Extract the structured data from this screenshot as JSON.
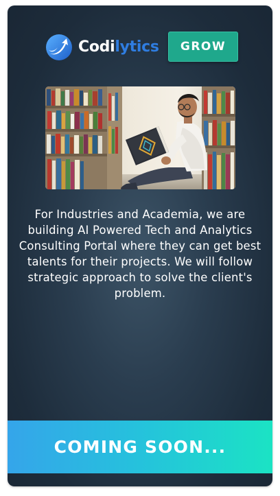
{
  "brand": {
    "name_part1": "Codi",
    "name_part2": "lytics",
    "logo_icon": "arrow-swoosh-icon"
  },
  "header": {
    "cta_label": "GROW"
  },
  "hero": {
    "image_icon": "student-reading-library-image"
  },
  "main": {
    "description": "For Industries and Academia, we are building AI Powered Tech and Analytics Consulting Portal where they can get best talents for their projects. We will follow strategic approach to solve the client's problem."
  },
  "footer": {
    "status_text": "COMING SOON..."
  },
  "colors": {
    "card_background": "#1d2c3b",
    "accent_blue": "#2f7de1",
    "grow_button": "#1fa88c",
    "footer_gradient_start": "#35a5ea",
    "footer_gradient_end": "#1be3c4"
  }
}
